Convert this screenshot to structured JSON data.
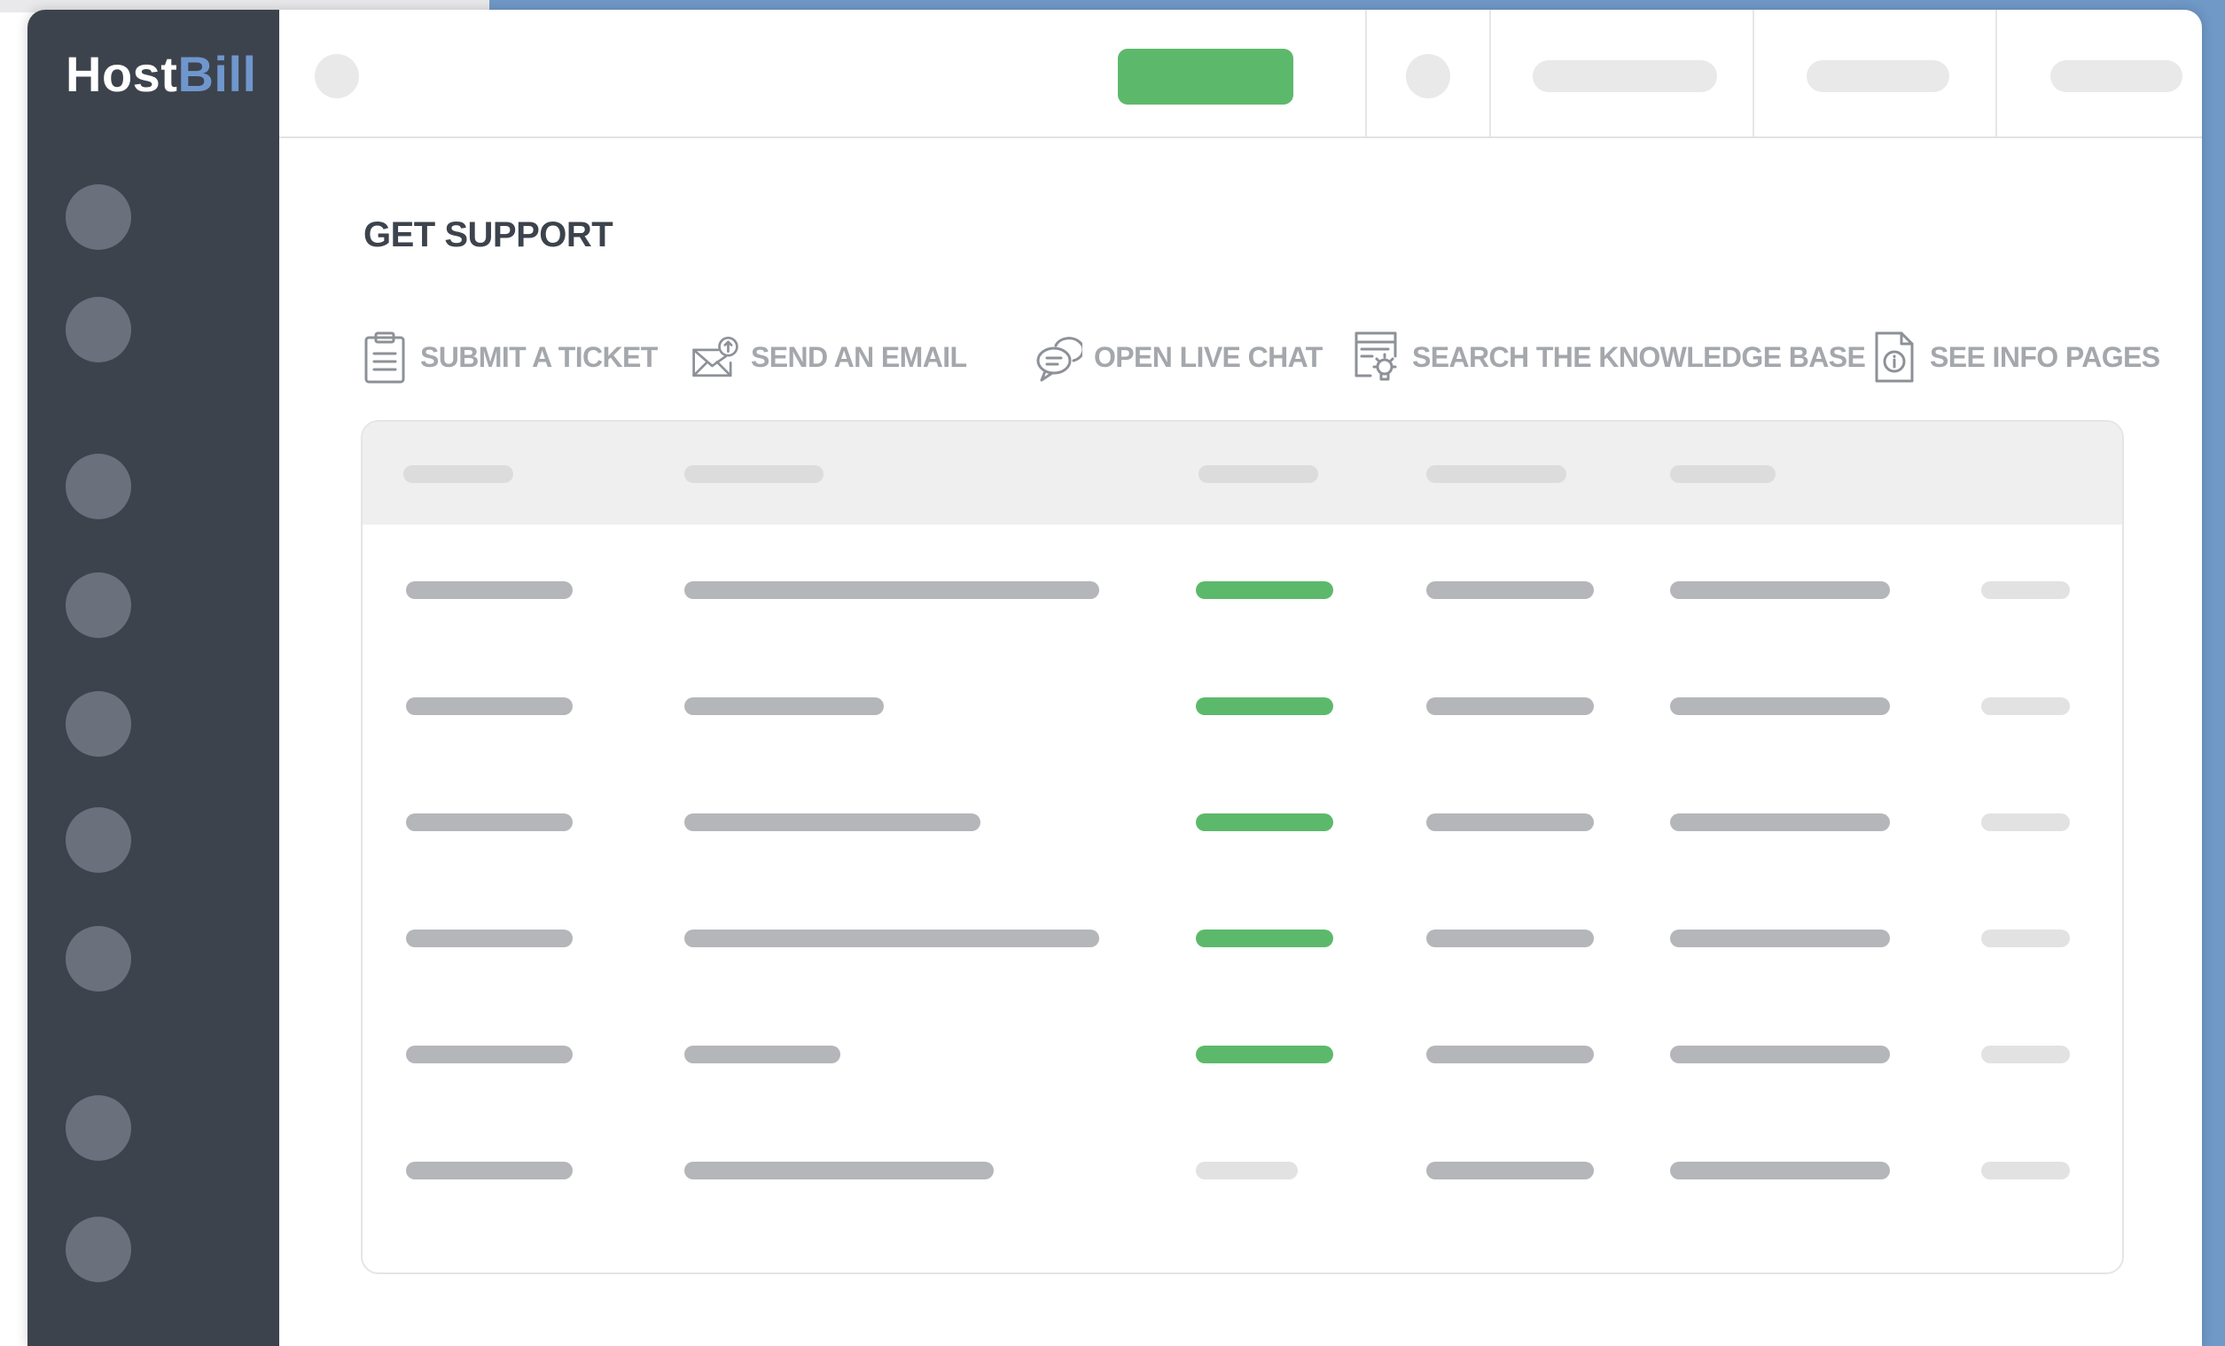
{
  "app": {
    "logo_primary": "Host",
    "logo_accent": "Bill",
    "accent_color": "#6f97cd",
    "sidebar_color": "#3d434d"
  },
  "page": {
    "title": "GET SUPPORT"
  },
  "actions": [
    {
      "label": "SUBMIT A TICKET",
      "icon": "clipboard-icon"
    },
    {
      "label": "SEND AN EMAIL",
      "icon": "envelope-icon"
    },
    {
      "label": "OPEN LIVE CHAT",
      "icon": "chat-bubbles-icon"
    },
    {
      "label": "SEARCH THE KNOWLEDGE BASE",
      "icon": "knowledge-base-icon"
    },
    {
      "label": "SEE INFO PAGES",
      "icon": "info-document-icon"
    }
  ],
  "status_colors": {
    "active": "#5cb96b",
    "inactive": "#e2e2e2"
  }
}
